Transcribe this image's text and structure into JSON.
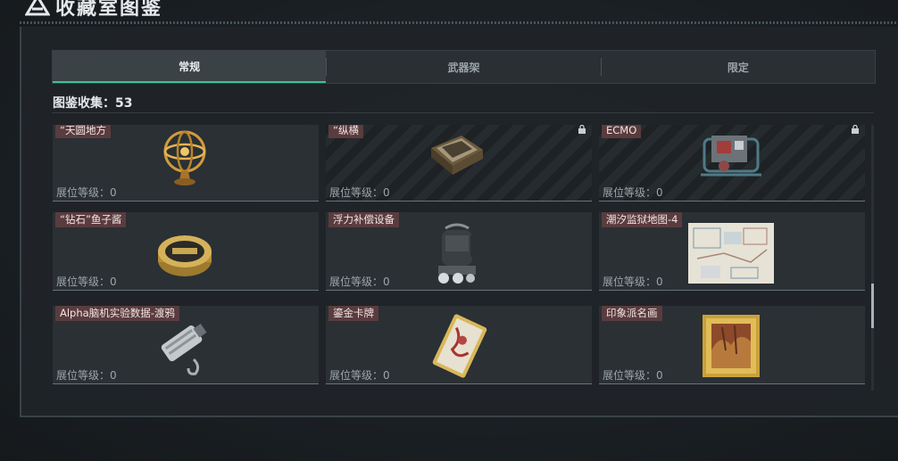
{
  "title": "收藏室图鉴",
  "tabs": [
    {
      "label": "常规",
      "active": true
    },
    {
      "label": "武器架",
      "active": false
    },
    {
      "label": "限定",
      "active": false
    }
  ],
  "collection_label": "图鉴收集：53",
  "level_label": "展位等级：0",
  "items": [
    {
      "tag": "“天圆地方",
      "locked": false,
      "icon": "armillary-sphere-icon"
    },
    {
      "tag": "“纵横",
      "locked": true,
      "icon": "chessboard-icon"
    },
    {
      "tag": "ECMO",
      "locked": true,
      "icon": "ecmo-machine-icon"
    },
    {
      "tag": "“钻石”鱼子酱",
      "locked": false,
      "icon": "caviar-tin-icon"
    },
    {
      "tag": "浮力补偿设备",
      "locked": false,
      "icon": "buoyancy-device-icon"
    },
    {
      "tag": "潮汐监狱地图-4",
      "locked": false,
      "icon": "map-icon"
    },
    {
      "tag": "Alpha脑机实验数据-渡鸦",
      "locked": false,
      "icon": "data-drive-icon"
    },
    {
      "tag": "鎏金卡牌",
      "locked": false,
      "icon": "gilded-card-icon"
    },
    {
      "tag": "印象派名画",
      "locked": false,
      "icon": "framed-painting-icon"
    }
  ],
  "colors": {
    "accent": "#3bc29a",
    "tag_bg": "#5a3c3e"
  }
}
